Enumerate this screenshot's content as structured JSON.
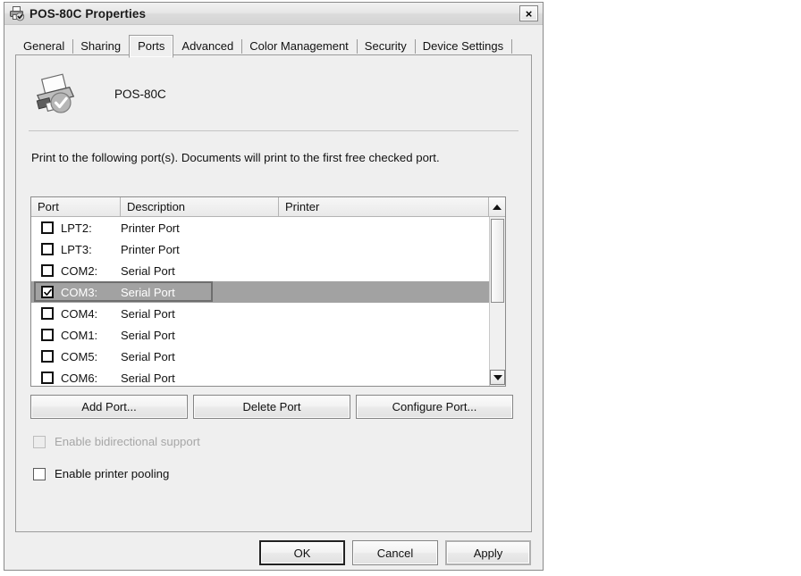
{
  "window": {
    "title": "POS-80C Properties",
    "icon": "printer-check-icon",
    "close_label": "×"
  },
  "tabs": [
    {
      "label": "General",
      "selected": false
    },
    {
      "label": "Sharing",
      "selected": false
    },
    {
      "label": "Ports",
      "selected": true
    },
    {
      "label": "Advanced",
      "selected": false
    },
    {
      "label": "Color Management",
      "selected": false
    },
    {
      "label": "Security",
      "selected": false
    },
    {
      "label": "Device Settings",
      "selected": false
    }
  ],
  "printer": {
    "name": "POS-80C",
    "icon": "printer-check-icon"
  },
  "instruction": "Print to the following port(s). Documents will print to the first free checked port.",
  "ports_list": {
    "columns": [
      "Port",
      "Description",
      "Printer"
    ],
    "rows": [
      {
        "checked": false,
        "port": "LPT2:",
        "description": "Printer Port",
        "printer": "",
        "selected": false
      },
      {
        "checked": false,
        "port": "LPT3:",
        "description": "Printer Port",
        "printer": "",
        "selected": false
      },
      {
        "checked": false,
        "port": "COM2:",
        "description": "Serial Port",
        "printer": "",
        "selected": false
      },
      {
        "checked": true,
        "port": "COM3:",
        "description": "Serial Port",
        "printer": "",
        "selected": true
      },
      {
        "checked": false,
        "port": "COM4:",
        "description": "Serial Port",
        "printer": "",
        "selected": false
      },
      {
        "checked": false,
        "port": "COM1:",
        "description": "Serial Port",
        "printer": "",
        "selected": false
      },
      {
        "checked": false,
        "port": "COM5:",
        "description": "Serial Port",
        "printer": "",
        "selected": false
      },
      {
        "checked": false,
        "port": "COM6:",
        "description": "Serial Port",
        "printer": "",
        "selected": false
      }
    ],
    "scroll_up_icon": "scroll-up-arrow-icon",
    "scroll_down_icon": "scroll-down-arrow-icon"
  },
  "port_buttons": {
    "add": "Add Port...",
    "delete": "Delete Port",
    "configure": "Configure Port..."
  },
  "options": [
    {
      "label": "Enable bidirectional support",
      "checked": false,
      "enabled": false
    },
    {
      "label": "Enable printer pooling",
      "checked": false,
      "enabled": true
    }
  ],
  "dialog_buttons": {
    "ok": "OK",
    "cancel": "Cancel",
    "apply": "Apply"
  },
  "colors": {
    "dialog_face": "#efefef",
    "selection": "#a2a2a2",
    "list_background": "#ffffff",
    "border": "#8c8c8c",
    "disabled_text": "#a6a6a6"
  }
}
